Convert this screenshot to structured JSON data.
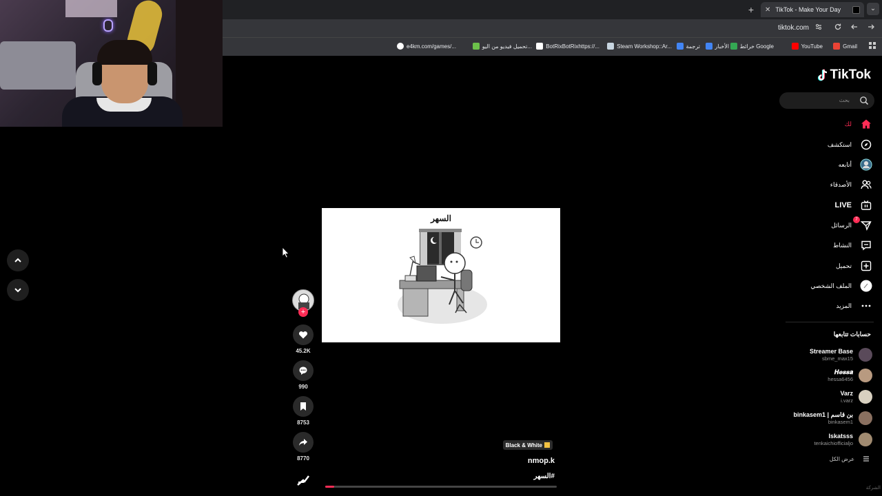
{
  "browser": {
    "tab_title": "TikTok - Make Your Day",
    "url": "tiktok.com",
    "new_tab_symbol": "+",
    "close_symbol": "✕",
    "tab_list_symbol": "⌄",
    "bookmarks": [
      {
        "label": "Gmail",
        "color": "#ea4335"
      },
      {
        "label": "YouTube",
        "color": "#ff0000"
      },
      {
        "label": "خرائط Google",
        "color": "#34a853"
      },
      {
        "label": "الأخبار",
        "color": "#4285f4"
      },
      {
        "label": "ترجمة",
        "color": "#4285f4"
      },
      {
        "label": "Steam Workshop::Ar...",
        "color": "#1b2838"
      },
      {
        "label": "BotRixBotRixhttps://...",
        "color": "#ffffff"
      },
      {
        "label": "تحميل فيديو من اليو...",
        "color": "#6cc04a"
      },
      {
        "label": "e4km.com/games/...",
        "color": "#ffffff"
      }
    ]
  },
  "tiktok": {
    "logo_text": "TikTok",
    "search_placeholder": "بحث",
    "menu": [
      {
        "label": "لك",
        "icon": "home-icon",
        "active": true
      },
      {
        "label": "استكشف",
        "icon": "compass-icon"
      },
      {
        "label": "أتابعه",
        "icon": "following-avatar-icon"
      },
      {
        "label": "الأصدقاء",
        "icon": "friends-icon"
      },
      {
        "label": "LIVE",
        "icon": "live-icon"
      },
      {
        "label": "الرسائل",
        "icon": "messages-icon",
        "badge": "7"
      },
      {
        "label": "النشاط",
        "icon": "activity-icon"
      },
      {
        "label": "تحميل",
        "icon": "upload-icon"
      },
      {
        "label": "الملف الشخصي",
        "icon": "profile-icon"
      },
      {
        "label": "المزيد",
        "icon": "more-icon"
      }
    ],
    "following_title": "حسابات تتابعها",
    "following": [
      {
        "name": "Streamer Base",
        "handle": "sbme_max15",
        "color": "#5a4a5a"
      },
      {
        "name": "𝑯𝒆𝒔𝒔𝒂",
        "handle": "hessa6456",
        "color": "#b89a80"
      },
      {
        "name": "Varz",
        "handle": "i.varz",
        "color": "#d8d0c0"
      },
      {
        "name": "binkasem1 | بن قاسم",
        "handle": "binkasem1",
        "color": "#8a7060"
      },
      {
        "name": "Iskatsss",
        "handle": "tenkaichiofficialjo",
        "color": "#a08a70"
      }
    ],
    "see_all": "عرض الكل",
    "bottom_cut": "الشركة"
  },
  "video": {
    "overlay_title": "السهر",
    "music_badge": "Black & White",
    "author": "nmop.k",
    "caption": "#السهر",
    "progress": 0.04,
    "likes": "45.2K",
    "comments": "990",
    "saves": "8753",
    "shares": "8770"
  }
}
